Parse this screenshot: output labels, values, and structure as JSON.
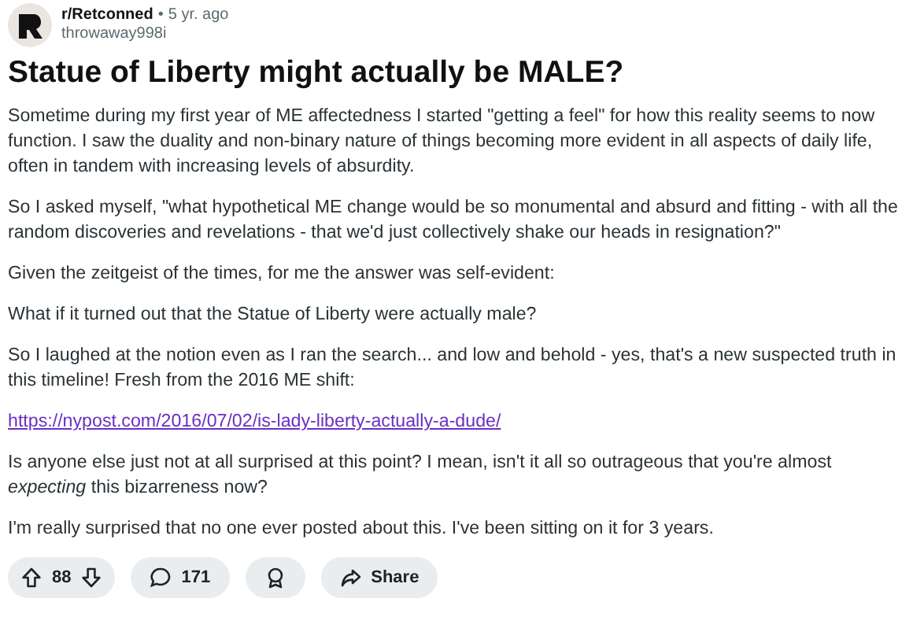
{
  "post": {
    "subreddit": "r/Retconned",
    "separator": "•",
    "age": "5 yr. ago",
    "author": "throwaway998i",
    "title": "Statue of Liberty might actually be MALE?",
    "body": [
      {
        "kind": "text",
        "text": "Sometime during my first year of ME affectedness I started \"getting a feel\" for how this reality seems to now function. I saw the duality and non-binary nature of things becoming more evident in all aspects of daily life, often in tandem with increasing levels of absurdity."
      },
      {
        "kind": "text",
        "text": "So I asked myself, \"what hypothetical ME change would be so monumental and absurd and fitting - with all the random discoveries and revelations - that we'd just collectively shake our heads in resignation?\""
      },
      {
        "kind": "text",
        "text": "Given the zeitgeist of the times, for me the answer was self-evident:"
      },
      {
        "kind": "text",
        "text": "What if it turned out that the Statue of Liberty were actually male?"
      },
      {
        "kind": "text",
        "text": "So I laughed at the notion even as I ran the search... and low and behold - yes, that's a new suspected truth in this timeline! Fresh from the 2016 ME shift:"
      },
      {
        "kind": "link",
        "text": "https://nypost.com/2016/07/02/is-lady-liberty-actually-a-dude/"
      },
      {
        "kind": "text",
        "text": "Is anyone else just not at all surprised at this point? I mean, isn't it all so outrageous that you're almost *expecting* this bizarreness now?"
      },
      {
        "kind": "text",
        "text": "I'm really surprised that no one ever posted about this. I've been sitting on it for 3 years."
      }
    ]
  },
  "actions": {
    "votes": "88",
    "comments": "171",
    "share": "Share"
  }
}
